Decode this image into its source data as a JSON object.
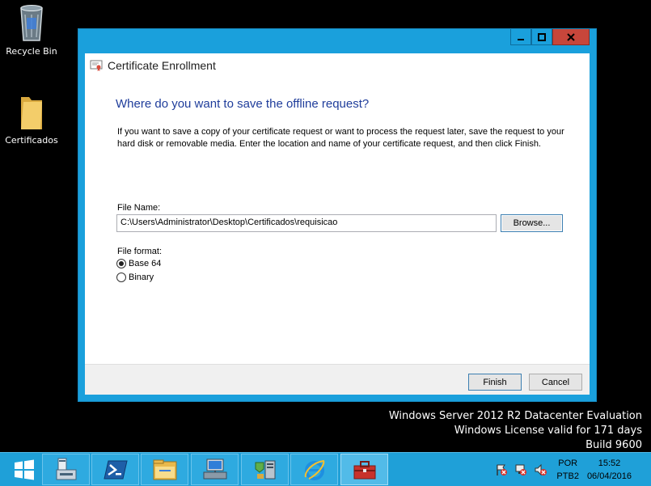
{
  "desktop": {
    "icons": [
      {
        "label": "Recycle Bin",
        "icon": "recycle-bin-icon"
      },
      {
        "label": "Certificados",
        "icon": "folder-icon"
      }
    ]
  },
  "window": {
    "title": "Certificate Enrollment",
    "heading": "Where do you want to save the offline request?",
    "description": "If you want to save a copy of your certificate request or want to process the request later, save the request to your hard disk or removable media. Enter the location and name of your certificate request, and then click Finish.",
    "file_name_label": "File Name:",
    "file_name_value": "C:\\Users\\Administrator\\Desktop\\Certificados\\requisicao",
    "browse_label": "Browse...",
    "file_format_label": "File format:",
    "formats": [
      {
        "label": "Base 64",
        "selected": true
      },
      {
        "label": "Binary",
        "selected": false
      }
    ],
    "finish_label": "Finish",
    "cancel_label": "Cancel"
  },
  "watermark": {
    "line1": "Windows Server 2012 R2 Datacenter Evaluation",
    "line2": "Windows License valid for 171 days",
    "line3": "Build 9600"
  },
  "taskbar": {
    "items": [
      "start-icon",
      "server-manager-icon",
      "powershell-icon",
      "file-explorer-icon",
      "network-computer-icon",
      "server-tools-icon",
      "internet-explorer-icon",
      "toolbox-icon"
    ],
    "active_item": "toolbox-icon",
    "lang_top": "POR",
    "lang_bottom": "PTB2",
    "time": "15:52",
    "date": "06/04/2016"
  },
  "colors": {
    "window_border": "#1aa0dc",
    "heading": "#1f3d9b",
    "taskbar": "#1fa0d8",
    "close_button": "#c7463b"
  }
}
